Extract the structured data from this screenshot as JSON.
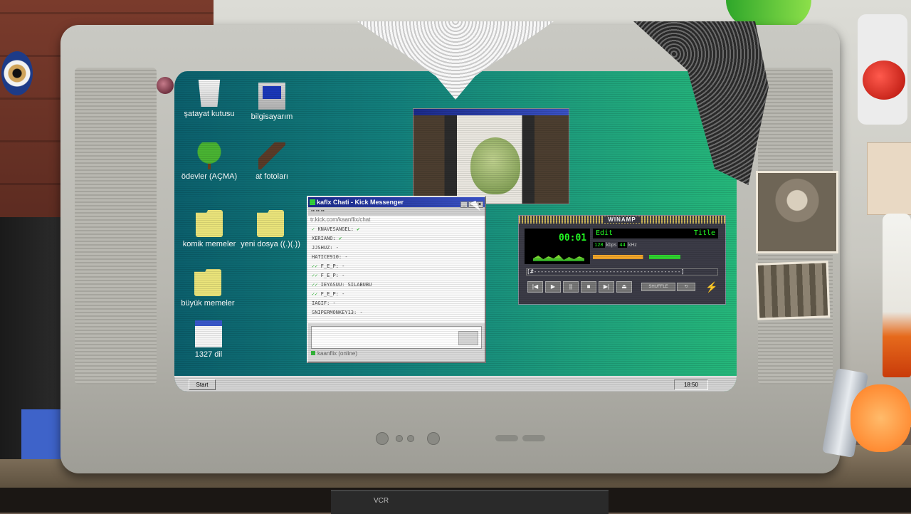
{
  "desktop": {
    "icons": [
      {
        "label": "şatayat kutusu",
        "icon": "recycle-bin-icon"
      },
      {
        "label": "bilgisayarım",
        "icon": "computer-icon"
      },
      {
        "label": "ödevler (AÇMA)",
        "icon": "tree-icon"
      },
      {
        "label": "at fotoları",
        "icon": "horse-icon"
      },
      {
        "label": "komik memeler",
        "icon": "folder-icon"
      },
      {
        "label": "yeni dosya ((.)(.))",
        "icon": "folder-icon"
      },
      {
        "label": "büyük memeler",
        "icon": "folder-icon"
      },
      {
        "label": "1327 dil",
        "icon": "calendar-icon"
      }
    ]
  },
  "chat_window": {
    "title": "kaflx Chati - Kick Messenger",
    "url": "tr.kick.com/kaanflix/chat",
    "messages": [
      {
        "user": "KNAVESANGEL:",
        "text": ""
      },
      {
        "user": "XERIANO:",
        "text": ""
      },
      {
        "user": "JJSHUZ:",
        "text": "-"
      },
      {
        "user": "HATICE910:",
        "text": "-"
      },
      {
        "user": "",
        "text": "F_E_P:  -"
      },
      {
        "user": "",
        "text": "F_E_P:  -"
      },
      {
        "user": "",
        "text": "IEYASUU: SILABUBU"
      },
      {
        "user": "",
        "text": "F_E_P:  -"
      },
      {
        "user": "IAGIF:",
        "text": "-"
      },
      {
        "user": "SNIPERMONKEY13:",
        "text": "-"
      }
    ],
    "status": "kaanflix (online)"
  },
  "winamp": {
    "title": "WINAMP",
    "time": "00:01",
    "song_left": "Edit",
    "song_right": "Title",
    "kbps": "128",
    "khz": "44",
    "kbps_label": "kbps",
    "khz_label": "kHz",
    "seek": "[#-------------------------------------------]",
    "shuffle": "SHUFFLE",
    "controls": [
      "|◀",
      "▶",
      "||",
      "■",
      "▶|",
      "⏏"
    ]
  },
  "taskbar": {
    "start": "Start",
    "clock": "18:50"
  },
  "vcr_label": "VCR",
  "colors": {
    "desktop": "#13807c",
    "title_bar": "#1b2a8a",
    "winamp_green": "#24ff24"
  }
}
